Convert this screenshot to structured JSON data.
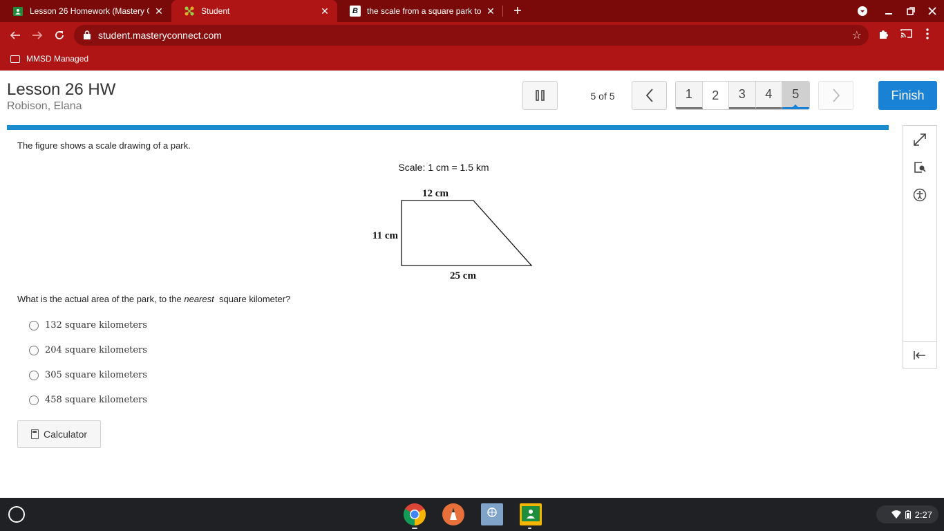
{
  "browser": {
    "tabs": [
      {
        "title": "Lesson 26 Homework (Mastery C",
        "icon": "classroom-icon",
        "active": false
      },
      {
        "title": "Student",
        "icon": "mastery-connect-icon",
        "active": true
      },
      {
        "title": "the scale from a square park to a",
        "icon": "brainly-icon",
        "active": false
      }
    ],
    "brainly_glyph": "B",
    "close_glyph": "✕",
    "url": "student.masteryconnect.com",
    "bookmark": "MMSD Managed"
  },
  "header": {
    "lesson_title": "Lesson 26 HW",
    "student_name": "Robison, Elana",
    "progress": "5 of 5",
    "questions": [
      "1",
      "2",
      "3",
      "4",
      "5"
    ],
    "current_question": "5",
    "finish_label": "Finish"
  },
  "question": {
    "stem": "The figure shows a scale drawing of a park.",
    "figure": {
      "scale_label": "Scale: 1 cm = 1.5 km",
      "top_label": "12 cm",
      "left_label": "11 cm",
      "bottom_label": "25 cm"
    },
    "prompt_before": "What is the actual area of the park, to the ",
    "prompt_emphasis": "nearest",
    "prompt_after": "  square kilometer?",
    "choices": [
      "132 square kilometers",
      "204 square kilometers",
      "305 square kilometers",
      "458 square kilometers"
    ]
  },
  "calculator_label": "Calculator",
  "shelf": {
    "apps": [
      "chrome-icon",
      "pencil-app-icon",
      "student-app-icon",
      "classroom-icon"
    ],
    "time": "2:27"
  },
  "colors": {
    "tabstrip": "#7a0a0a",
    "toolbar": "#b01515",
    "accent": "#1a82d4",
    "progress_bar": "#1a8bcf"
  }
}
